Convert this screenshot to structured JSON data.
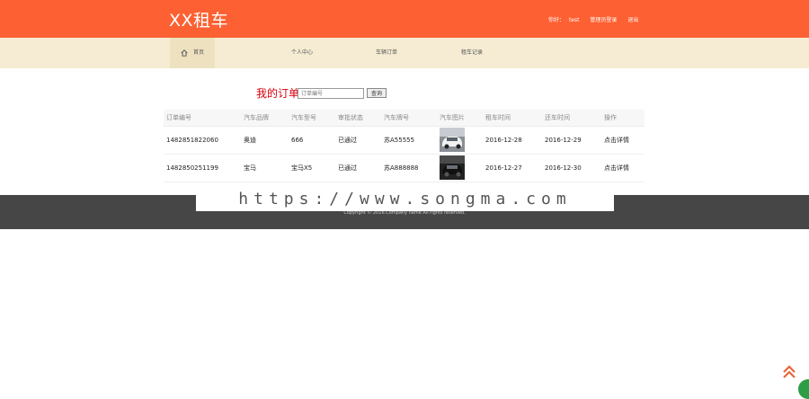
{
  "header": {
    "logo": "XX租车",
    "user_greeting": "你好：",
    "username": "test",
    "admin_login": "管理员登录",
    "logout": "退出"
  },
  "nav": {
    "items": [
      {
        "label": "首页"
      },
      {
        "label": "个人中心"
      },
      {
        "label": "车辆订单"
      },
      {
        "label": "租车记录"
      }
    ]
  },
  "search": {
    "title": "我的订单",
    "placeholder": "订单编号",
    "button": "查询"
  },
  "table": {
    "columns": [
      "订单编号",
      "汽车品牌",
      "汽车型号",
      "审批状态",
      "汽车牌号",
      "汽车图片",
      "租车时间",
      "还车时间",
      "操作"
    ],
    "rows": [
      {
        "order_no": "1482851822060",
        "brand": "奥迪",
        "model": "666",
        "status": "已通过",
        "plate": "苏A55555",
        "rent_date": "2016-12-28",
        "return_date": "2016-12-29",
        "action": "点击详情"
      },
      {
        "order_no": "1482850251199",
        "brand": "宝马",
        "model": "宝马X5",
        "status": "已通过",
        "plate": "苏A888888",
        "rent_date": "2016-12-27",
        "return_date": "2016-12-30",
        "action": "点击详情"
      }
    ]
  },
  "footer": {
    "copyright": "Copyright © 2016.Company name All rights reserved."
  },
  "watermark": "https://www.songma.com",
  "colors": {
    "header": "#fd6032",
    "nav": "#f5ecd3",
    "title": "#d8000c",
    "footer": "#464646"
  }
}
